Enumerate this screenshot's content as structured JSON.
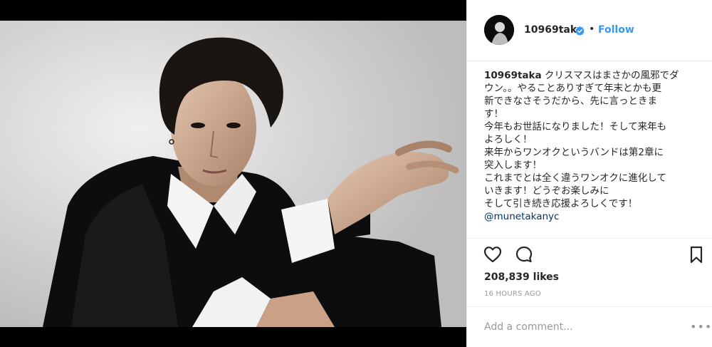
{
  "post": {
    "author": {
      "username": "10969taka",
      "verified": true,
      "follow_label": "Follow",
      "separator": "•"
    },
    "caption": {
      "username": "10969taka",
      "lines": [
        "クリスマスはまさかの風邪でダ",
        "ウン。。やることありすぎて年末とかも更",
        "新できなさそうだから、先に言っときま",
        "す！",
        "今年もお世話になりました！そして来年も",
        "よろしく！",
        "来年からワンオクというバンドは第2章に",
        "突入します！",
        "これまでとは全く違うワンオクに進化して",
        "いきます！どうぞお楽しみに",
        "そして引き続き応援よろしくです！"
      ],
      "mention": "@munetakanyc"
    },
    "likes": "208,839 likes",
    "timestamp": "16 HOURS AGO",
    "comment": {
      "placeholder": "Add a comment...",
      "more": "•••"
    },
    "icons": {
      "like": "heart-icon",
      "comment": "comment-bubble-icon",
      "save": "bookmark-icon",
      "verified": "verified-badge-icon"
    },
    "colors": {
      "follow": "#3897f0",
      "verified": "#3897f0",
      "mention": "#003569",
      "muted": "#999999",
      "text": "#262626"
    }
  }
}
